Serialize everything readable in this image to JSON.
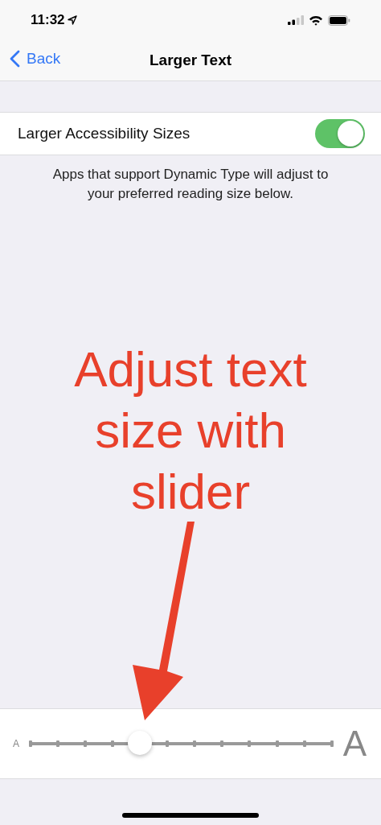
{
  "status_bar": {
    "time": "11:32"
  },
  "nav_bar": {
    "back": "Back",
    "title": "Larger Text"
  },
  "setting": {
    "label": "Larger Accessibility Sizes",
    "on": true
  },
  "footer": "Apps that support Dynamic Type will adjust to your preferred reading size below.",
  "annotation": {
    "text": "Adjust text size with slider"
  },
  "slider": {
    "min_label": "A",
    "max_label": "A",
    "level": 0.364
  }
}
